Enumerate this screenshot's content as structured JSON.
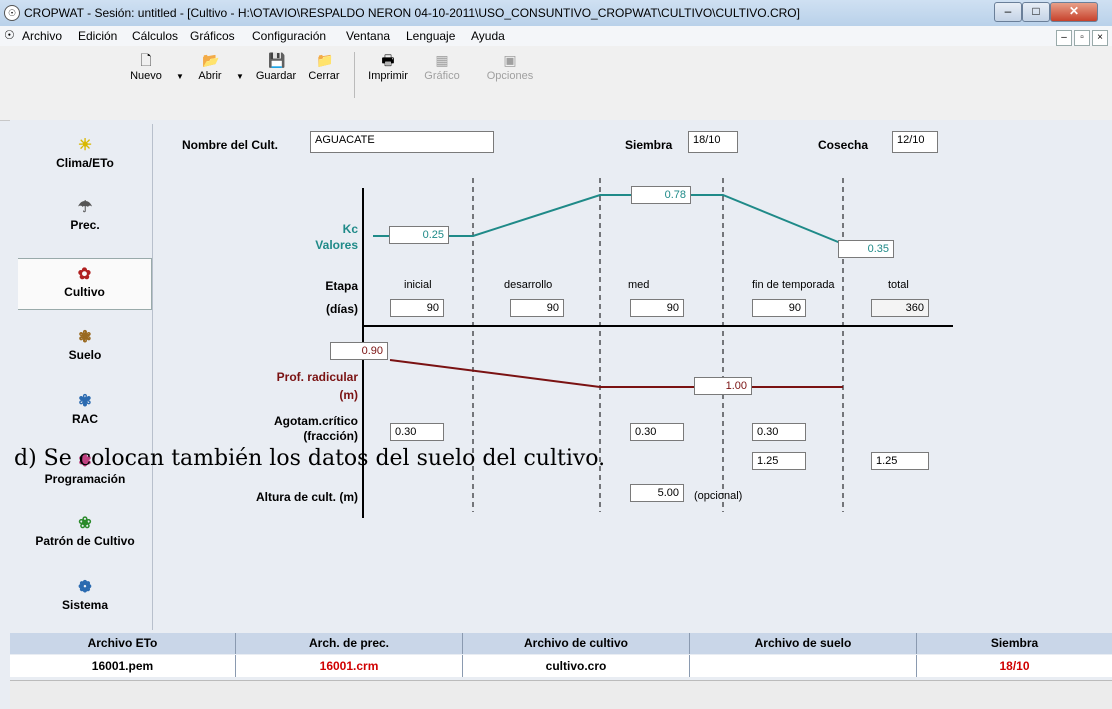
{
  "window": {
    "title": "CROPWAT - Sesión: untitled - [Cultivo - H:\\OTAVIO\\RESPALDO NERON 04-10-2011\\USO_CONSUNTIVO_CROPWAT\\CULTIVO\\CULTIVO.CRO]"
  },
  "menu": [
    "Archivo",
    "Edición",
    "Cálculos",
    "Gráficos",
    "Configuración",
    "Ventana",
    "Lenguaje",
    "Ayuda"
  ],
  "toolbar": {
    "nuevo": "Nuevo",
    "abrir": "Abrir",
    "guardar": "Guardar",
    "cerrar": "Cerrar",
    "imprimir": "Imprimir",
    "grafico": "Gráfico",
    "opciones": "Opciones"
  },
  "sidebar": [
    "Clima/ETo",
    "Prec.",
    "Cultivo",
    "Suelo",
    "RAC",
    "Programación",
    "Patrón de Cultivo",
    "Sistema"
  ],
  "form": {
    "crop_name_label": "Nombre del Cult.",
    "crop_name": "AGUACATE",
    "siembra_label": "Siembra",
    "siembra": "18/10",
    "cosecha_label": "Cosecha",
    "cosecha": "12/10",
    "kc_label_1": "Kc",
    "kc_label_2": "Valores",
    "kc_ini": "0.25",
    "kc_mid": "0.78",
    "kc_end": "0.35",
    "etapa_label": "Etapa",
    "dias_label": "(días)",
    "stages": [
      "inicial",
      "desarrollo",
      "med",
      "fin de temporada",
      "total"
    ],
    "stage_days": [
      "90",
      "90",
      "90",
      "90",
      "360"
    ],
    "root_label_1": "Prof. radicular",
    "root_label_2": "(m)",
    "root_ini": "0.90",
    "root_max": "1.00",
    "agotam_label_1": "Agotam.crítico",
    "agotam_label_2": "(fracción)",
    "agotam": [
      "0.30",
      "0.30",
      "0.30"
    ],
    "ky_values": [
      "1.25",
      "1.25"
    ],
    "altura_label": "Altura de cult. (m)",
    "altura": "5.00",
    "altura_note": "(opcional)"
  },
  "overlay_text": "d)  Se colocan también los datos del suelo del cultivo.",
  "status": {
    "headers": [
      "Archivo ETo",
      "Arch. de prec.",
      "Archivo de cultivo",
      "Archivo de suelo",
      "Siembra"
    ],
    "values": [
      "16001.pem",
      "16001.crm",
      "cultivo.cro",
      "",
      "18/10"
    ]
  },
  "colors": {
    "teal": "#1f8a88",
    "maroon": "#7a1212",
    "red": "#d00000"
  }
}
